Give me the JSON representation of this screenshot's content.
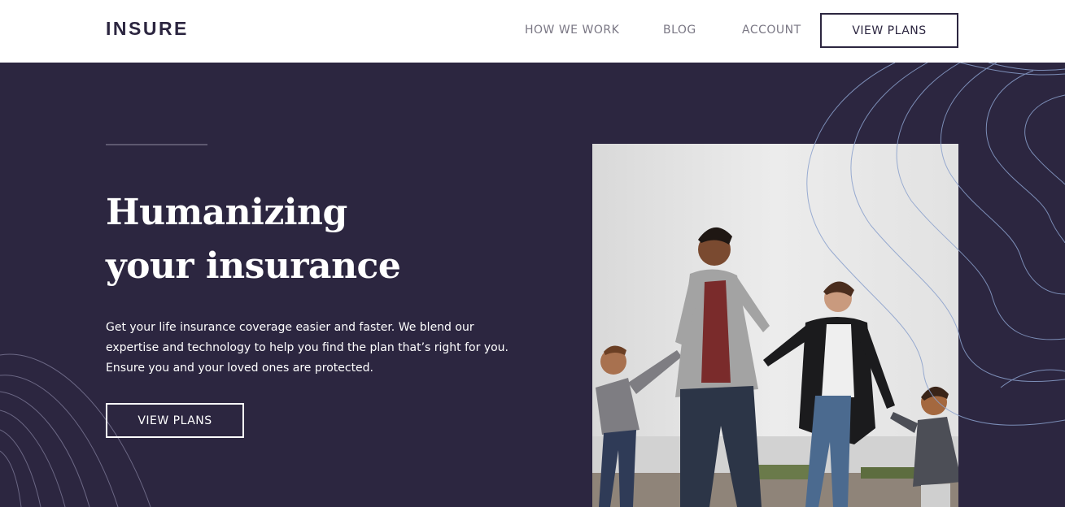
{
  "header": {
    "logo": "INSURE",
    "nav": [
      {
        "label": "HOW WE WORK"
      },
      {
        "label": "BLOG"
      },
      {
        "label": "ACCOUNT"
      }
    ],
    "cta_label": "VIEW PLANS"
  },
  "hero": {
    "title_line1": "Humanizing",
    "title_line2": "your insurance",
    "description": "Get your life insurance coverage easier and faster. We blend our expertise and technology to help you find the plan that’s right for you. Ensure you and your loved ones are protected.",
    "cta_label": "VIEW PLANS",
    "image_subject": "family-walking-photo"
  },
  "colors": {
    "dark_violet": "#2c2640",
    "white": "#ffffff",
    "nav_gray": "#7a7784",
    "pattern_line": "#8aa0cc"
  }
}
